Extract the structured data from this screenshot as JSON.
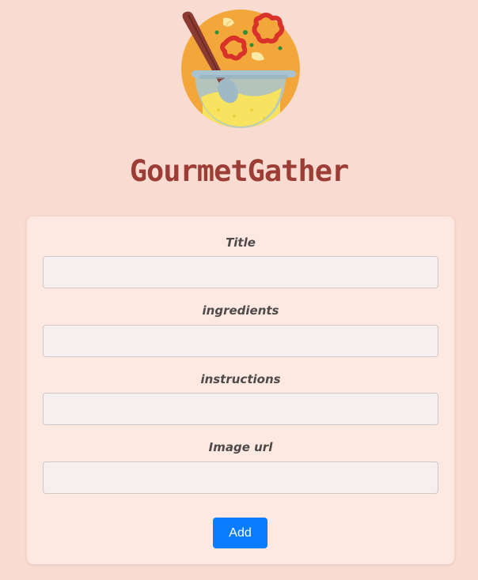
{
  "app": {
    "title": "GourmetGather"
  },
  "logo": {
    "icon": "mixing-bowl-icon"
  },
  "form": {
    "fields": [
      {
        "label": "Title",
        "value": "",
        "placeholder": ""
      },
      {
        "label": "ingredients",
        "value": "",
        "placeholder": ""
      },
      {
        "label": "instructions",
        "value": "",
        "placeholder": ""
      },
      {
        "label": "Image url",
        "value": "",
        "placeholder": ""
      }
    ],
    "submit_label": "Add"
  },
  "colors": {
    "page_background": "#f8dcd2",
    "card_background": "#fde9e1",
    "title": "#9c3d36",
    "button": "#0a7cff",
    "input_background": "#f5f0ef"
  }
}
